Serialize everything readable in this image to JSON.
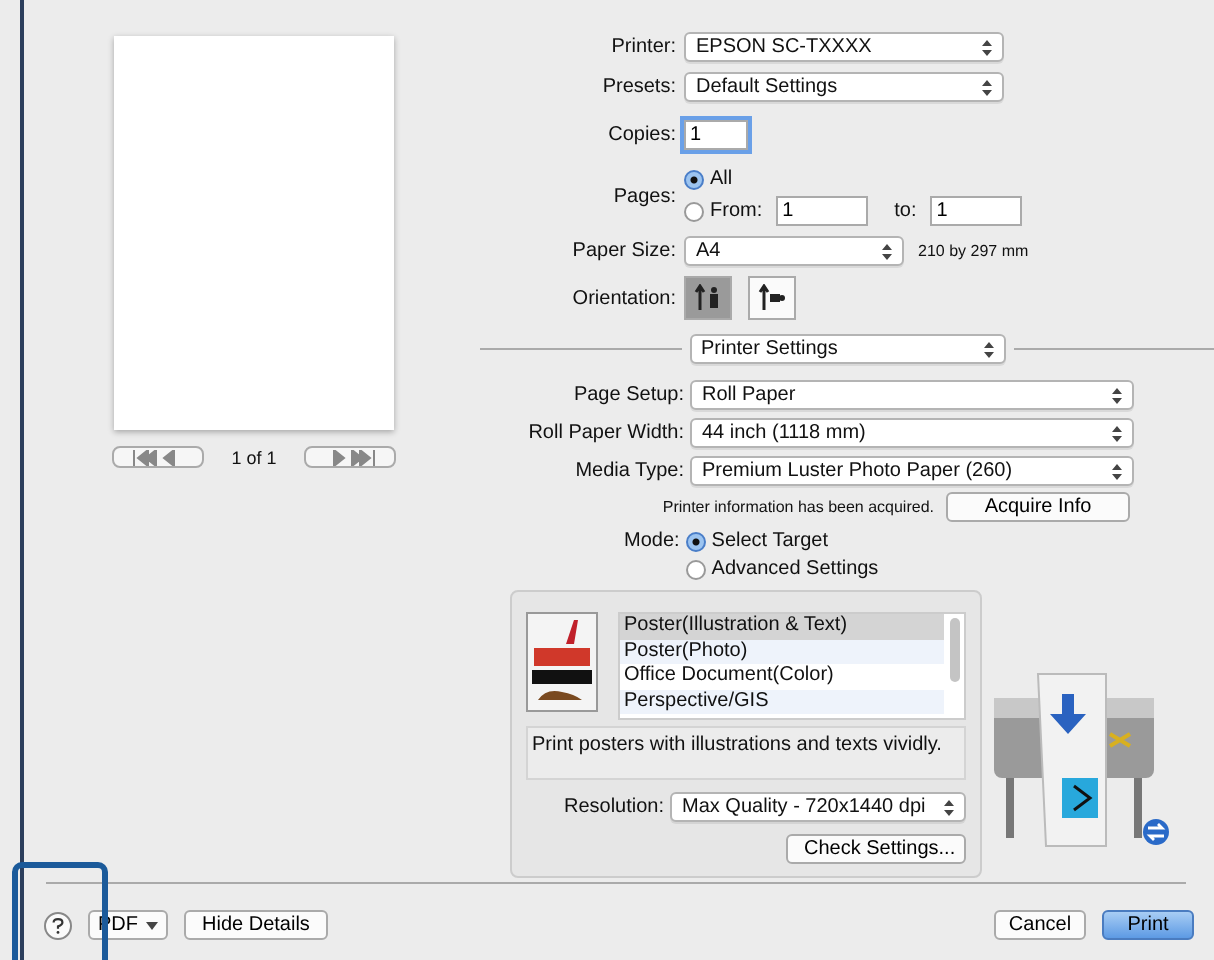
{
  "preview": {
    "page_indicator": "1 of 1"
  },
  "printer": {
    "label": "Printer:",
    "value": "EPSON SC-TXXXX"
  },
  "presets": {
    "label": "Presets:",
    "value": "Default Settings"
  },
  "copies": {
    "label": "Copies:",
    "value": "1"
  },
  "pages": {
    "label": "Pages:",
    "options": [
      {
        "label": "All",
        "selected": true
      },
      {
        "label": "From:",
        "selected": false
      }
    ],
    "from": "1",
    "to_label": "to:",
    "to": "1"
  },
  "paper_size": {
    "label": "Paper Size:",
    "value": "A4",
    "note": "210 by 297 mm"
  },
  "orientation": {
    "label": "Orientation:",
    "options": [
      {
        "kind": "portrait",
        "selected": true
      },
      {
        "kind": "landscape",
        "selected": false
      }
    ]
  },
  "panel_menu": {
    "value": "Printer Settings"
  },
  "page_setup": {
    "label": "Page Setup:",
    "value": "Roll Paper"
  },
  "roll_paper_width": {
    "label": "Roll Paper Width:",
    "value": "44 inch (1118 mm)"
  },
  "media_type": {
    "label": "Media Type:",
    "value": "Premium Luster Photo Paper (260)"
  },
  "printer_info": {
    "message": "Printer information has been acquired.",
    "button": "Acquire Info"
  },
  "mode": {
    "label": "Mode:",
    "options": [
      {
        "label": "Select Target",
        "selected": true
      },
      {
        "label": "Advanced Settings",
        "selected": false
      }
    ]
  },
  "targets": {
    "items": [
      {
        "label": "Poster(Illustration & Text)",
        "selected": true
      },
      {
        "label": "Poster(Photo)",
        "selected": false
      },
      {
        "label": "Office Document(Color)",
        "selected": false
      },
      {
        "label": "Perspective/GIS",
        "selected": false
      }
    ],
    "description": "Print posters with illustrations and texts vividly.",
    "resolution_label": "Resolution:",
    "resolution": "Max Quality - 720x1440 dpi",
    "check_button": "Check Settings..."
  },
  "footer": {
    "pdf_button": "PDF",
    "details_button": "Hide Details",
    "buttons": [
      {
        "label": "Cancel",
        "kind": "normal"
      },
      {
        "label": "Print",
        "kind": "default"
      }
    ]
  }
}
